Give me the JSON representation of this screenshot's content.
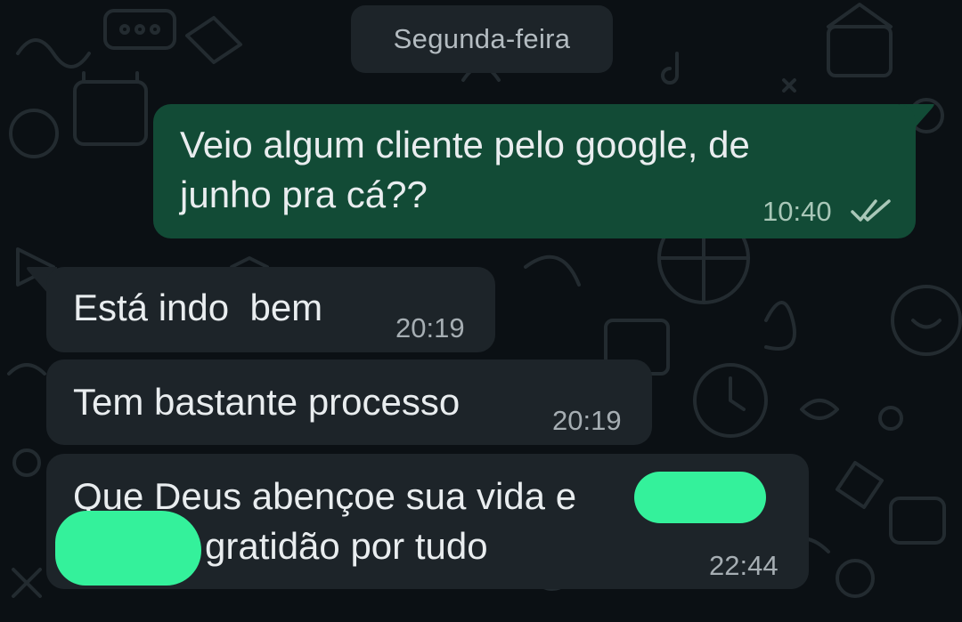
{
  "chat": {
    "date_separator": "Segunda-feira",
    "messages": [
      {
        "direction": "outgoing",
        "lines": [
          "Veio algum cliente pelo google, de",
          "junho pra cá??"
        ],
        "time": "10:40",
        "status": "read",
        "status_icon": "double-check-icon"
      },
      {
        "direction": "incoming",
        "text": "Está indo  bem",
        "time": "20:19"
      },
      {
        "direction": "incoming",
        "text": "Tem bastante processo",
        "time": "20:19"
      },
      {
        "direction": "incoming",
        "lines": [
          "Que Deus abençoe sua vida e",
          "gratidão por tudo"
        ],
        "time": "22:44",
        "redacted_segments": 2
      }
    ]
  },
  "colors": {
    "background": "#0b1014",
    "outgoing_bubble": "#124b36",
    "incoming_bubble": "#1d2429",
    "text": "#e9edef",
    "timestamp": "#a6aeb3",
    "redaction": "#34f19b"
  }
}
